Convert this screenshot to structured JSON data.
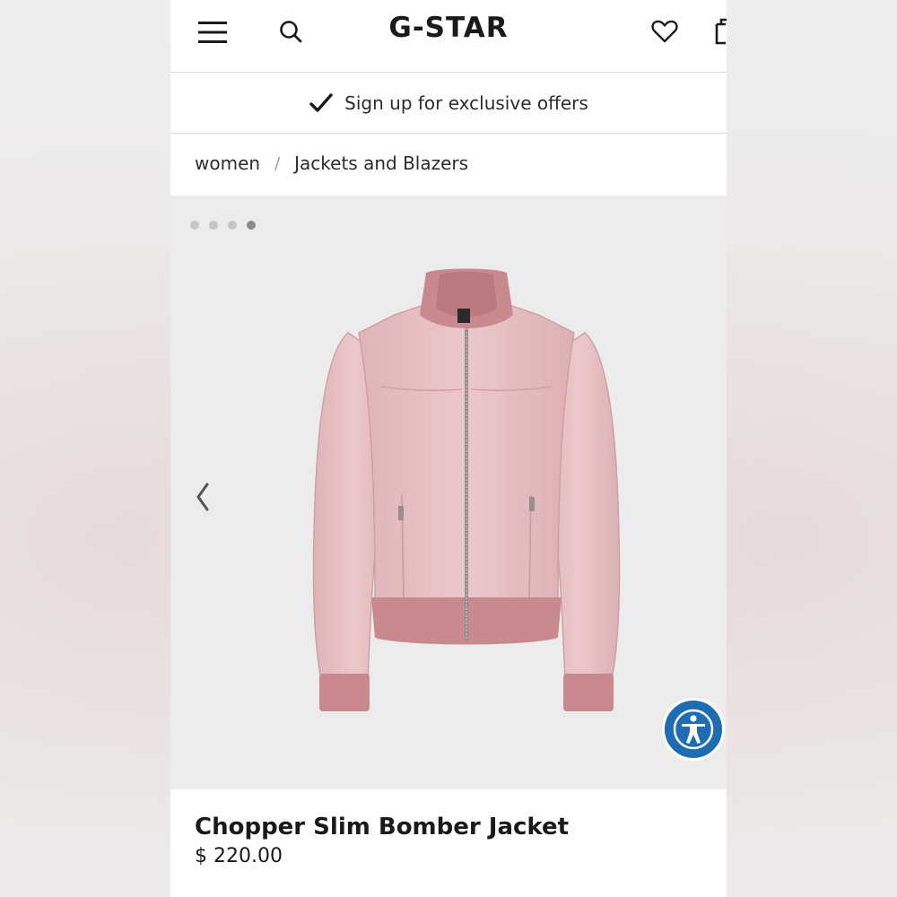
{
  "header": {
    "logo": "G-STAR",
    "icons": [
      "menu-icon",
      "search-icon",
      "heart-icon",
      "shopping-bag-icon"
    ]
  },
  "banner": {
    "text": "Sign up for exclusive offers",
    "icon": "checkmark-icon"
  },
  "breadcrumb": {
    "items": [
      "women",
      "Jackets and Blazers"
    ],
    "separator": "/"
  },
  "gallery": {
    "current_slide": 4,
    "total_slides": 4,
    "image_description_icon": "jacket-image",
    "prev_icon": "chevron-left-icon",
    "accessibility_icon": "accessibility-icon"
  },
  "product": {
    "name": "Chopper Slim Bomber Jacket",
    "price": "$ 220.00"
  },
  "colors": {
    "accessibility_blue": "#1e6db3",
    "jacket_pink": "#e8c3c6",
    "rib_pink": "#c98a8f"
  }
}
